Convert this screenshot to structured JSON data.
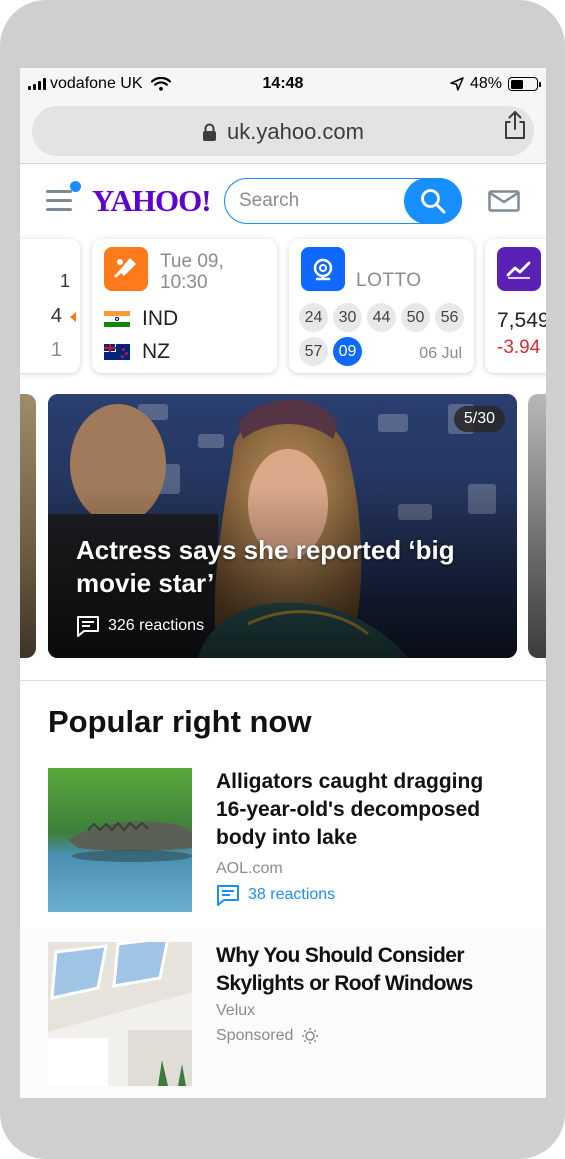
{
  "status_bar": {
    "carrier": "vodafone UK",
    "time": "14:48",
    "battery": "48%",
    "battery_level": 0.48
  },
  "browser": {
    "url": "uk.yahoo.com"
  },
  "header": {
    "logo": "YAHOO!",
    "search_placeholder": "Search",
    "colors": {
      "brand": "#6001d2",
      "accent": "#188fff"
    }
  },
  "cards": {
    "partial_left": {
      "top": "1",
      "mid": "4",
      "bottom": "1"
    },
    "cricket": {
      "date": "Tue 09,",
      "time": "10:30",
      "team1": "IND",
      "team2": "NZ"
    },
    "lotto": {
      "label": "LOTTO",
      "numbers": [
        "24",
        "30",
        "44",
        "50",
        "56",
        "57"
      ],
      "bonus": "09",
      "date": "06 Jul"
    },
    "stock": {
      "value": "7,549",
      "change": "-3.94"
    }
  },
  "hero": {
    "counter": "5/30",
    "title": "Actress says she reported ‘big movie star’",
    "reactions": "326 reactions"
  },
  "popular": {
    "heading": "Popular right now",
    "articles": [
      {
        "headline": "Alligators caught dragging 16-year-old's decomposed body into lake",
        "source": "AOL.com",
        "reactions": "38 reactions"
      },
      {
        "headline": "Why You Should Consider Skylights or Roof Windows",
        "source": "Velux",
        "sponsored": "Sponsored"
      }
    ]
  }
}
